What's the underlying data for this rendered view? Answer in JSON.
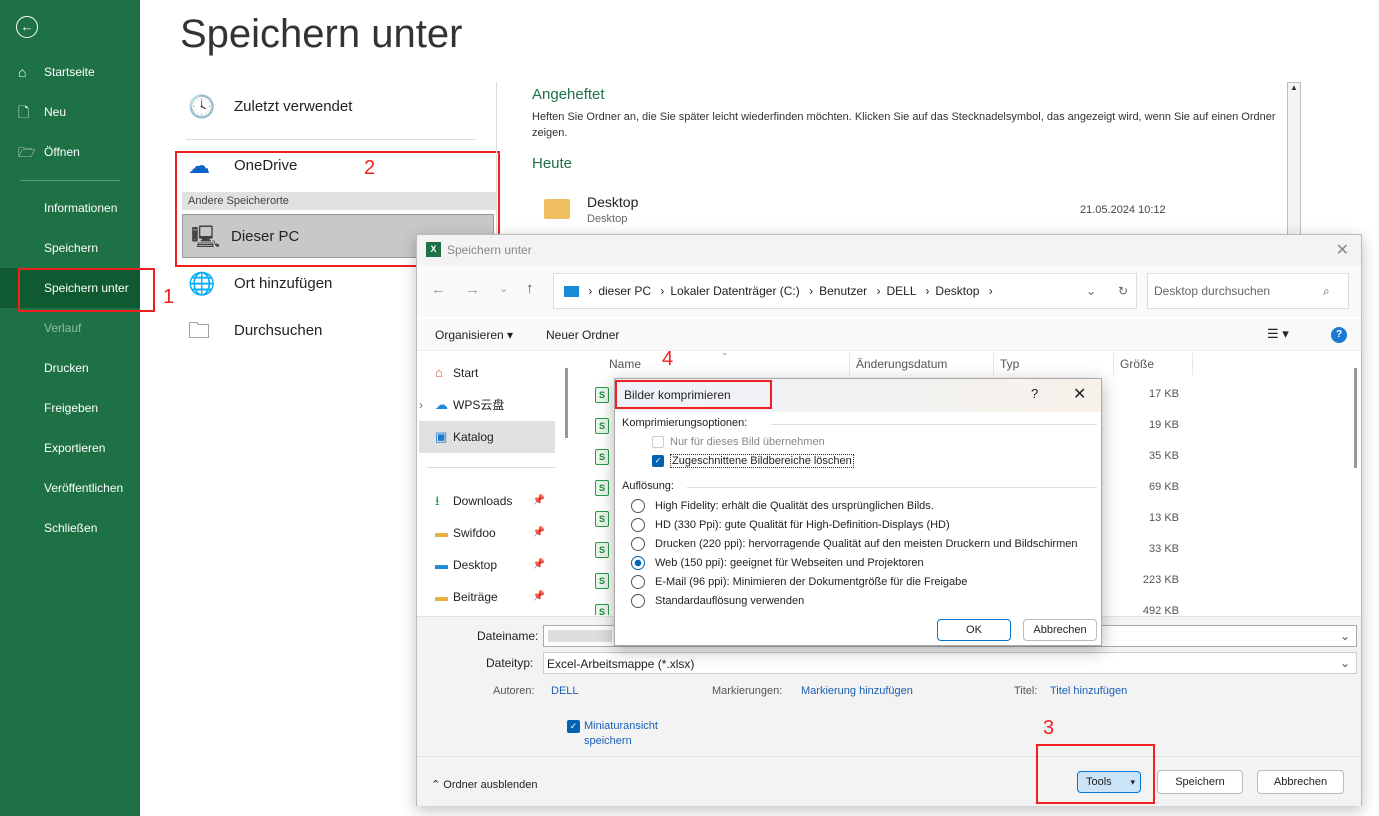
{
  "sidebar": {
    "items": [
      {
        "label": "Startseite",
        "icon": "home-icon"
      },
      {
        "label": "Neu",
        "icon": "new-file-icon"
      },
      {
        "label": "Öffnen",
        "icon": "folder-open-icon"
      },
      {
        "label": "Informationen"
      },
      {
        "label": "Speichern"
      },
      {
        "label": "Speichern unter",
        "selected": true
      },
      {
        "label": "Verlauf",
        "disabled": true
      },
      {
        "label": "Drucken"
      },
      {
        "label": "Freigeben"
      },
      {
        "label": "Exportieren"
      },
      {
        "label": "Veröffentlichen"
      },
      {
        "label": "Schließen"
      }
    ]
  },
  "backstage": {
    "title": "Speichern unter",
    "locations": {
      "recent": "Zuletzt verwendet",
      "onedrive": "OneDrive",
      "other_header": "Andere Speicherorte",
      "this_pc": "Dieser PC",
      "add_place": "Ort hinzufügen",
      "browse": "Durchsuchen"
    },
    "pinned_title": "Angeheftet",
    "pinned_text": "Heften Sie Ordner an, die Sie später leicht wiederfinden möchten. Klicken Sie auf das Stecknadelsymbol, das angezeigt wird, wenn Sie auf einen Ordner zeigen.",
    "today_title": "Heute",
    "recent_folder": {
      "name": "Desktop",
      "path": "Desktop",
      "date": "21.05.2024 10:12"
    }
  },
  "annotations": [
    "1",
    "2",
    "3",
    "4"
  ],
  "save_dialog": {
    "title": "Speichern unter",
    "breadcrumb": [
      "dieser PC",
      "Lokaler Datenträger (C:)",
      "Benutzer",
      "DELL",
      "Desktop"
    ],
    "search_placeholder": "Desktop durchsuchen",
    "organize": "Organisieren",
    "new_folder": "Neuer Ordner",
    "nav": [
      {
        "label": "Start"
      },
      {
        "label": "WPS云盘"
      },
      {
        "label": "Katalog"
      },
      {
        "label": "Downloads"
      },
      {
        "label": "Swifdoo"
      },
      {
        "label": "Desktop"
      },
      {
        "label": "Beiträge"
      }
    ],
    "columns": {
      "name": "Name",
      "date": "Änderungsdatum",
      "type": "Typ",
      "size": "Größe"
    },
    "sizes": [
      "17 KB",
      "19 KB",
      "35 KB",
      "69 KB",
      "13 KB",
      "33 KB",
      "223 KB",
      "492 KB"
    ],
    "filename_label": "Dateiname:",
    "filetype_label": "Dateityp:",
    "filetype_value": "Excel-Arbeitsmappe (*.xlsx)",
    "authors_label": "Autoren:",
    "authors_value": "DELL",
    "tags_label": "Markierungen:",
    "tags_value": "Markierung hinzufügen",
    "title_label": "Titel:",
    "title_value": "Titel hinzufügen",
    "thumbnail": "Miniaturansicht speichern",
    "hide_folders": "Ordner ausblenden",
    "tools": "Tools",
    "save": "Speichern",
    "cancel": "Abbrechen"
  },
  "compress_dialog": {
    "title": "Bilder komprimieren",
    "help": "?",
    "options_label": "Komprimierungsoptionen:",
    "only_this": "Nur für dieses Bild übernehmen",
    "delete_cropped": "Zugeschnittene Bildbereiche löschen",
    "resolution_label": "Auflösung:",
    "resolutions": [
      {
        "label": "High Fidelity: erhält die Qualität des ursprünglichen Bilds.",
        "selected": false
      },
      {
        "label": "HD (330 Ppi): gute Qualität für High-Definition-Displays (HD)",
        "selected": false
      },
      {
        "label": "Drucken (220 ppi): hervorragende Qualität auf den meisten Druckern und Bildschirmen",
        "selected": false
      },
      {
        "label": "Web (150 ppi): geeignet für Webseiten und Projektoren",
        "selected": true
      },
      {
        "label": "E-Mail (96 ppi): Minimieren der Dokumentgröße für die Freigabe",
        "selected": false
      },
      {
        "label": "Standardauflösung verwenden",
        "selected": false
      }
    ],
    "ok": "OK",
    "cancel": "Abbrechen"
  },
  "colors": {
    "excel_green": "#1e7145",
    "selected_green": "#0f5a30",
    "annotation_red": "#f02020",
    "accent_blue": "#0063b1"
  }
}
